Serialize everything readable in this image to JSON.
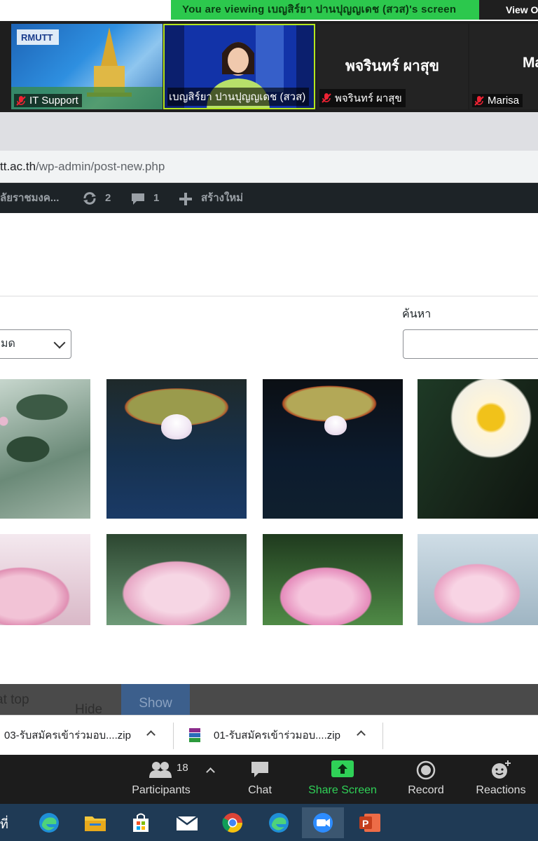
{
  "zoom": {
    "viewing_banner": "You are viewing เบญสิร์ยา ปานปุญญเดช (สวส)'s screen",
    "view_options": "View O",
    "participants": [
      {
        "name": "IT Support",
        "big_name": ""
      },
      {
        "name": "เบญสิร์ยา ปานปุญญเดช (สวส)",
        "big_name": ""
      },
      {
        "name": "พจรินทร์ ผาสุข",
        "big_name": "พจรินทร์ ผาสุข"
      },
      {
        "name": "Marisa",
        "big_name": "Ma"
      }
    ],
    "toolbar": {
      "participants_label": "Participants",
      "participants_count": "18",
      "chat_label": "Chat",
      "share_label": "Share Screen",
      "record_label": "Record",
      "reactions_label": "Reactions"
    }
  },
  "browser": {
    "url_host": "tt.ac.th",
    "url_path": "/wp-admin/post-new.php"
  },
  "wp_admin_bar": {
    "site_name": "ลัยราชมงค...",
    "updates_count": "2",
    "comments_count": "1",
    "new_label": "สร้างใหม่"
  },
  "media": {
    "filter_value": "มด",
    "search_label": "ค้นหา",
    "search_placeholder": ""
  },
  "overlay": {
    "left_text": "at top",
    "hide_label": "Hide",
    "show_label": "Show"
  },
  "downloads": [
    {
      "name": "03-รับสมัครเข้าร่วมอบ....zip"
    },
    {
      "name": "01-รับสมัครเข้าร่วมอบ....zip"
    }
  ],
  "taskbar": {
    "search_fragment": "ที่"
  }
}
